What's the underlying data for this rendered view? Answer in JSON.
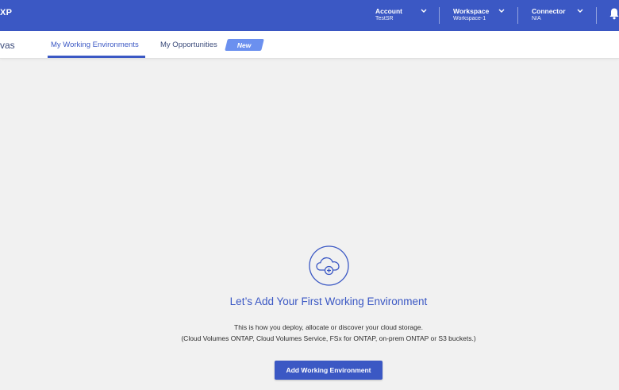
{
  "header": {
    "logo_fragment": "XP",
    "account": {
      "label": "Account",
      "value": "TestSR"
    },
    "workspace": {
      "label": "Workspace",
      "value": "Workspace-1"
    },
    "connector": {
      "label": "Connector",
      "value": "N/A"
    }
  },
  "tabs": {
    "page_title_fragment": "vas",
    "items": [
      {
        "label": "My Working Environments",
        "active": true
      },
      {
        "label": "My Opportunities",
        "active": false
      }
    ],
    "badge": "New"
  },
  "empty_state": {
    "icon": "cloud-plus-icon",
    "title": "Let’s Add Your First Working Environment",
    "description_line1": "This is how you deploy, allocate or discover your cloud storage.",
    "description_line2": "(Cloud Volumes ONTAP, Cloud Volumes Service, FSx for ONTAP, on-prem ONTAP or S3 buckets.)",
    "button_label": "Add Working Environment"
  },
  "colors": {
    "brand_blue": "#3b58c4",
    "badge_blue": "#6b90ef",
    "canvas_background": "#f1f1f1"
  }
}
